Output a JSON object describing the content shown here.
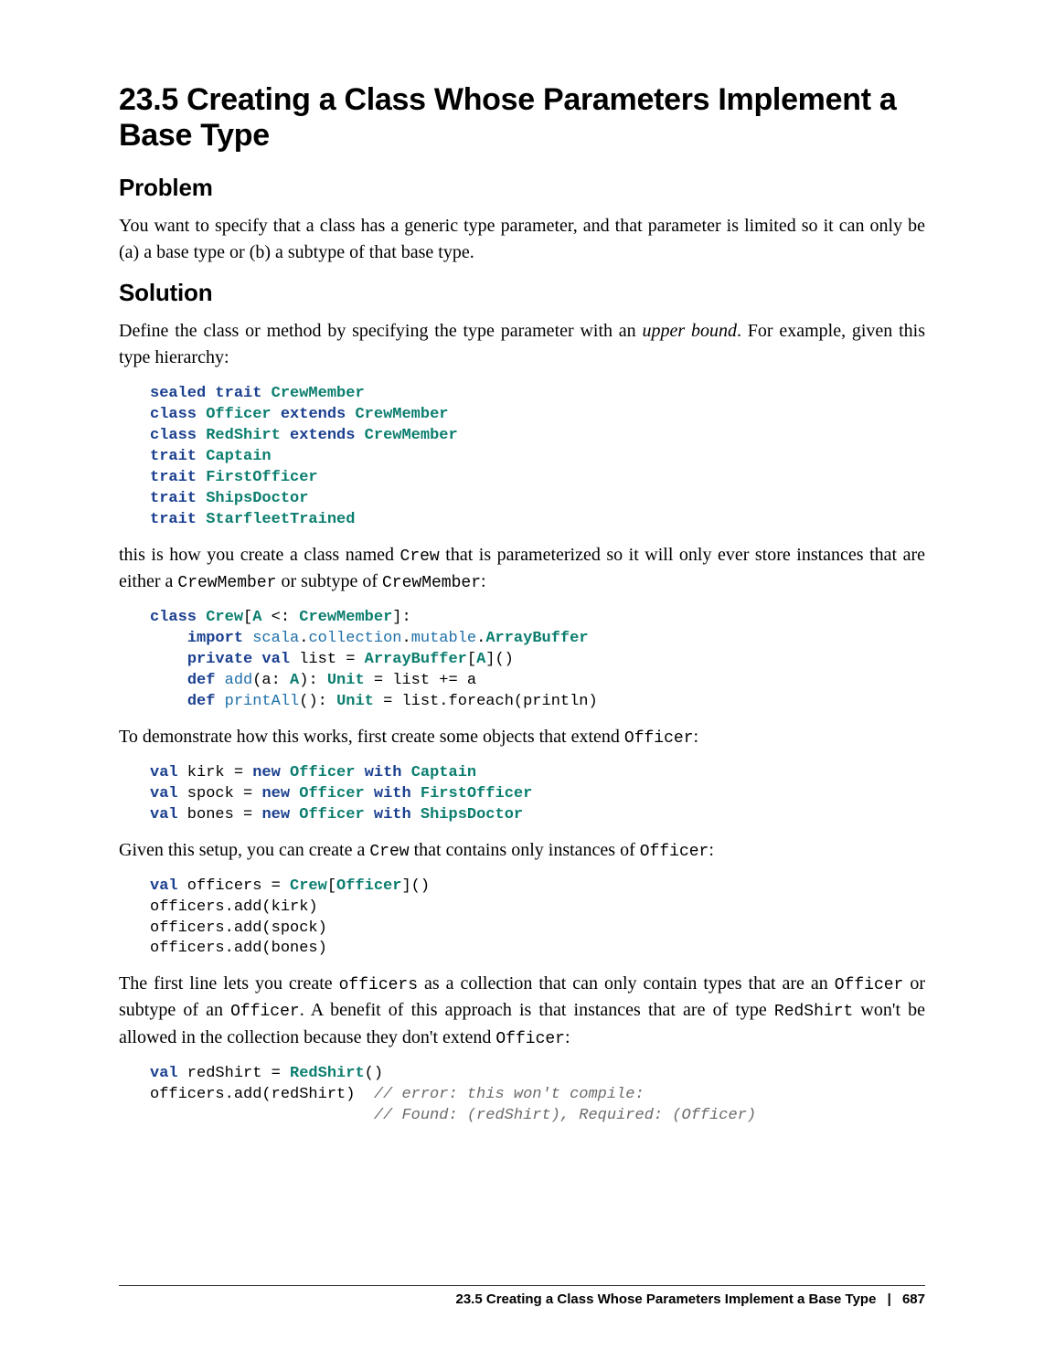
{
  "section_title": "23.5 Creating a Class Whose Parameters Implement a Base Type",
  "problem_heading": "Problem",
  "problem_text": "You want to specify that a class has a generic type parameter, and that parameter is limited so it can only be (a) a base type or (b) a subtype of that base type.",
  "solution_heading": "Solution",
  "solution_intro_a": "Define the class or method by specifying the type parameter with an ",
  "solution_intro_em": "upper bound",
  "solution_intro_b": ". For example, given this type hierarchy:",
  "code1": {
    "l1a": "sealed trait",
    "l1b": "CrewMember",
    "l2a": "class",
    "l2b": "Officer",
    "l2c": "extends",
    "l2d": "CrewMember",
    "l3a": "class",
    "l3b": "RedShirt",
    "l3c": "extends",
    "l3d": "CrewMember",
    "l4a": "trait",
    "l4b": "Captain",
    "l5a": "trait",
    "l5b": "FirstOfficer",
    "l6a": "trait",
    "l6b": "ShipsDoctor",
    "l7a": "trait",
    "l7b": "StarfleetTrained"
  },
  "para2a": "this is how you create a class named ",
  "para2b": "Crew",
  "para2c": " that is parameterized so it will only ever store instances that are either a ",
  "para2d": "CrewMember",
  "para2e": " or subtype of ",
  "para2f": "CrewMember",
  "para2g": ":",
  "code2": {
    "l1a": "class",
    "l1b": "Crew",
    "l1c": "[",
    "l1d": "A",
    "l1e": " <: ",
    "l1f": "CrewMember",
    "l1g": "]:",
    "l2a": "    ",
    "l2b": "import",
    "l2c": " scala",
    "l2d": ".",
    "l2e": "collection",
    "l2f": ".",
    "l2g": "mutable",
    "l2h": ".",
    "l2i": "ArrayBuffer",
    "l3a": "    ",
    "l3b": "private val",
    "l3c": " list = ",
    "l3d": "ArrayBuffer",
    "l3e": "[",
    "l3f": "A",
    "l3g": "]()",
    "l4a": "    ",
    "l4b": "def",
    "l4c": " ",
    "l4d": "add",
    "l4e": "(a: ",
    "l4f": "A",
    "l4g": "): ",
    "l4h": "Unit",
    "l4i": " = list += a",
    "l5a": "    ",
    "l5b": "def",
    "l5c": " ",
    "l5d": "printAll",
    "l5e": "(): ",
    "l5f": "Unit",
    "l5g": " = list.foreach(println)"
  },
  "para3a": "To demonstrate how this works, first create some objects that extend ",
  "para3b": "Officer",
  "para3c": ":",
  "code3": {
    "l1a": "val",
    "l1b": " kirk = ",
    "l1c": "new",
    "l1d": " ",
    "l1e": "Officer",
    "l1f": " ",
    "l1g": "with",
    "l1h": " ",
    "l1i": "Captain",
    "l2a": "val",
    "l2b": " spock = ",
    "l2c": "new",
    "l2d": " ",
    "l2e": "Officer",
    "l2f": " ",
    "l2g": "with",
    "l2h": " ",
    "l2i": "FirstOfficer",
    "l3a": "val",
    "l3b": " bones = ",
    "l3c": "new",
    "l3d": " ",
    "l3e": "Officer",
    "l3f": " ",
    "l3g": "with",
    "l3h": " ",
    "l3i": "ShipsDoctor"
  },
  "para4a": "Given this setup, you can create a ",
  "para4b": "Crew",
  "para4c": " that contains only instances of ",
  "para4d": "Officer",
  "para4e": ":",
  "code4": {
    "l1a": "val",
    "l1b": " officers = ",
    "l1c": "Crew",
    "l1d": "[",
    "l1e": "Officer",
    "l1f": "]()",
    "l2": "officers.add(kirk)",
    "l3": "officers.add(spock)",
    "l4": "officers.add(bones)"
  },
  "para5a": "The first line lets you create ",
  "para5b": "officers",
  "para5c": " as a collection that can only contain types that are an ",
  "para5d": "Officer",
  "para5e": " or subtype of an ",
  "para5f": "Officer",
  "para5g": ". A benefit of this approach is that instances that are of type ",
  "para5h": "RedShirt",
  "para5i": " won't be allowed in the collection because they don't extend ",
  "para5j": "Officer",
  "para5k": ":",
  "code5": {
    "l1a": "val",
    "l1b": " redShirt = ",
    "l1c": "RedShirt",
    "l1d": "()",
    "l2a": "officers.add(redShirt)  ",
    "l2b": "// error: this won't compile:",
    "l3a": "                        ",
    "l3b": "// Found: (redShirt), Required: (Officer)"
  },
  "footer_title": "23.5 Creating a Class Whose Parameters Implement a Base Type",
  "footer_sep": "|",
  "footer_page": "687"
}
